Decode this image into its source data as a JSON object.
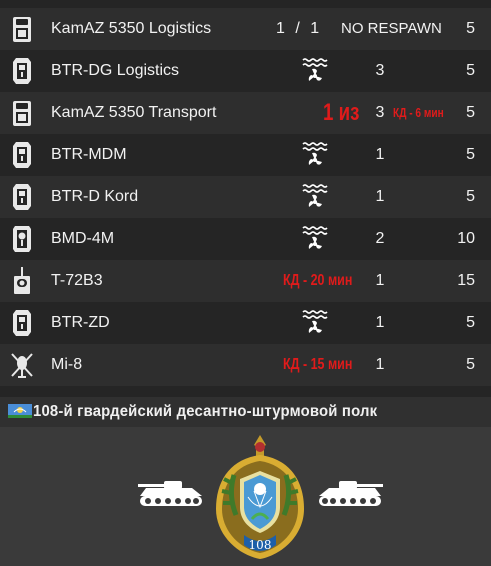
{
  "vehicles": [
    {
      "name": "KamAZ 5350 Logistics",
      "fraction": "1 / 1",
      "status": "NO RESPAWN",
      "max": "5",
      "icon": "truck-icon"
    },
    {
      "name": "BTR-DG Logistics",
      "count": "3",
      "max": "5",
      "icon": "apc-icon",
      "amphibious": true
    },
    {
      "name": "KamAZ 5350 Transport",
      "note_left": "1 из",
      "count": "3",
      "note_right": "КД - 6 мин",
      "max": "5",
      "icon": "truck-icon"
    },
    {
      "name": "BTR-MDM",
      "count": "1",
      "max": "5",
      "icon": "apc-icon",
      "amphibious": true
    },
    {
      "name": "BTR-D Kord",
      "count": "1",
      "max": "5",
      "icon": "apc-icon",
      "amphibious": true
    },
    {
      "name": "BMD-4M",
      "count": "2",
      "max": "10",
      "icon": "ifv-icon",
      "amphibious": true
    },
    {
      "name": "T-72B3",
      "cooldown": "КД - 20 мин",
      "count": "1",
      "max": "15",
      "icon": "tank-icon"
    },
    {
      "name": "BTR-ZD",
      "count": "1",
      "max": "5",
      "icon": "apc-icon",
      "amphibious": true
    },
    {
      "name": "Mi-8",
      "cooldown": "КД - 15 мин",
      "count": "1",
      "max": "5",
      "icon": "helicopter-icon"
    }
  ],
  "banner": {
    "title": "108-й гвардейский десантно-штурмовой полк",
    "flag_icon": "vdv-flag-icon"
  },
  "emblem": {
    "number": "108",
    "icon": "regiment-emblem-icon",
    "side_icons": "bmd-silhouette-icon"
  },
  "colors": {
    "cooldown_red": "#e01b1b",
    "list_bg": "#252525",
    "page_bg": "#3a3a3a"
  }
}
